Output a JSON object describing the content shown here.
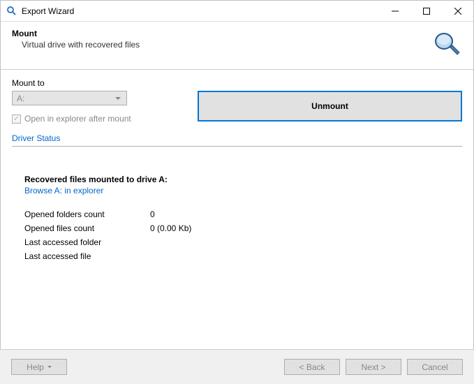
{
  "window": {
    "title": "Export Wizard"
  },
  "header": {
    "title": "Mount",
    "subtitle": "Virtual drive with recovered files"
  },
  "mount": {
    "label": "Mount to",
    "selectedDrive": "A:",
    "checkboxLabel": "Open in explorer after mount",
    "unmountLabel": "Unmount",
    "driverStatusLink": "Driver Status"
  },
  "recovered": {
    "title": "Recovered files mounted to drive A:",
    "browseLink": "Browse A: in explorer",
    "stats": {
      "openedFoldersLabel": "Opened folders count",
      "openedFoldersValue": "0",
      "openedFilesLabel": "Opened files count",
      "openedFilesValue": "0 (0.00 Kb)",
      "lastAccessedFolderLabel": "Last accessed folder",
      "lastAccessedFolderValue": "",
      "lastAccessedFileLabel": "Last accessed file",
      "lastAccessedFileValue": ""
    }
  },
  "footer": {
    "help": "Help",
    "back": "< Back",
    "next": "Next >",
    "cancel": "Cancel"
  }
}
